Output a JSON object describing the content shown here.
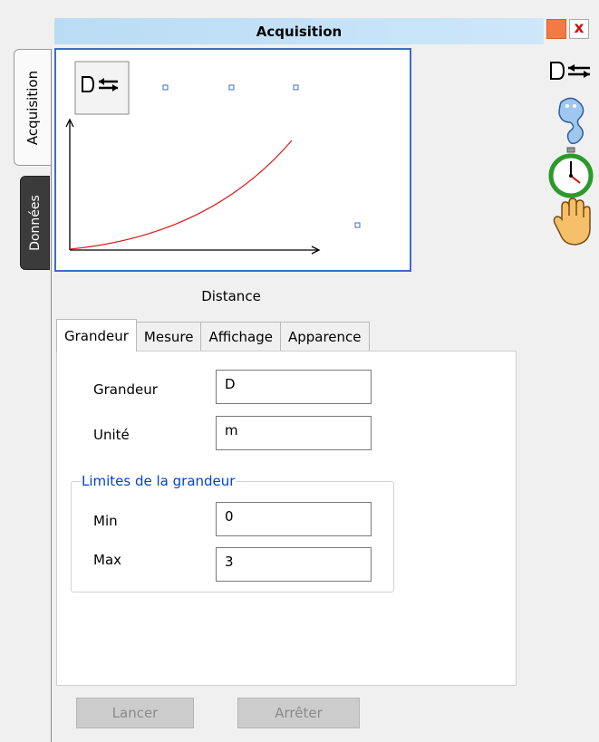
{
  "window": {
    "title": "Acquisition",
    "close_glyph": "x"
  },
  "vertical_tabs": [
    {
      "label": "Acquisition",
      "active": true
    },
    {
      "label": "Données",
      "active": false
    }
  ],
  "preview": {
    "caption": "Distance",
    "curve_color": "#e01818",
    "frame_color": "#3c6fc6"
  },
  "tabs": [
    {
      "label": "Grandeur",
      "active": true
    },
    {
      "label": "Mesure",
      "active": false
    },
    {
      "label": "Affichage",
      "active": false
    },
    {
      "label": "Apparence",
      "active": false
    }
  ],
  "form": {
    "grandeur_label": "Grandeur",
    "grandeur_value": "D",
    "unite_label": "Unité",
    "unite_value": "m",
    "limits_group_label": "Limites de la grandeur",
    "min_label": "Min",
    "min_value": "0",
    "max_label": "Max",
    "max_value": "3"
  },
  "buttons": {
    "start": "Lancer",
    "stop": "Arrêter"
  },
  "toolbar_icons": [
    "sensor-icon",
    "ghost-icon",
    "stopwatch-icon",
    "hand-icon"
  ]
}
